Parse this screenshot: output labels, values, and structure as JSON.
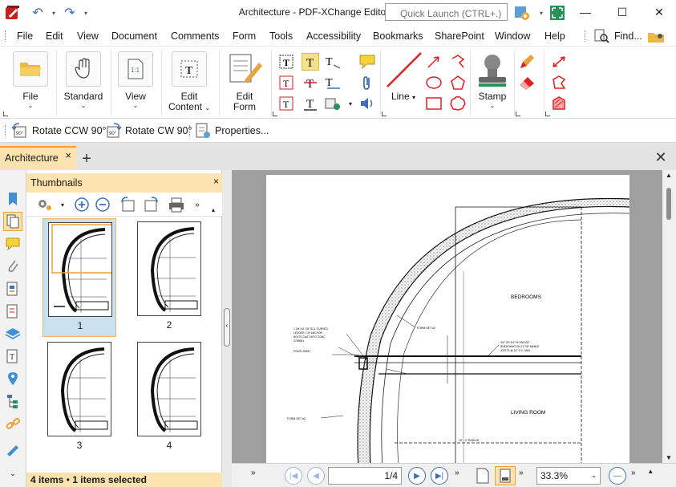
{
  "window": {
    "title": "Architecture - PDF-XChange Editor",
    "quick_launch_placeholder": "Quick Launch (CTRL+.)",
    "minimize": "—",
    "maximize": "☐",
    "close": "✕"
  },
  "menu": {
    "items": [
      "File",
      "Edit",
      "View",
      "Document",
      "Comments",
      "Form",
      "Tools",
      "Accessibility",
      "Bookmarks",
      "SharePoint",
      "Window",
      "Help"
    ],
    "find_label": "Find..."
  },
  "ribbon": {
    "file": "File",
    "standard": "Standard",
    "view": "View",
    "edit_content_1": "Edit",
    "edit_content_2": "Content",
    "edit_form_1": "Edit",
    "edit_form_2": "Form",
    "line": "Line",
    "stamp": "Stamp"
  },
  "toolbar2": {
    "rotate_ccw": "Rotate CCW 90°",
    "rotate_cw": "Rotate CW 90°",
    "properties": "Properties..."
  },
  "tabs": {
    "doc_tab": "Architecture",
    "close_tab": "×",
    "new_tab": "+",
    "close_all": "✕"
  },
  "thumbnails": {
    "title": "Thumbnails",
    "close": "×",
    "pages": [
      "1",
      "2",
      "3",
      "4"
    ],
    "status_count": "4 items",
    "status_selected": "1 items selected"
  },
  "drawing": {
    "bedrooms": "BEDROOMS",
    "living_room": "LIVING ROOM",
    "form_set": "FORM SET #2",
    "form_set_2": "FORM SET #2",
    "pour_joint": "POUR JOINT",
    "note_left_1": "1 3/4\"x11 7/8\" SCL 'CURVED",
    "note_left_2": "LEDGER. CIV ANCHOR",
    "note_left_3": "BOLTS CAST INTO CONC",
    "note_left_4": "CORBEL",
    "note_right_1": "3/4\" OR 3/4\" PLYWOOD",
    "note_right_2": "SHEATHING ON 11 7/8\" MANUF",
    "note_right_3": "JOISTS @ 16\" O.C. MAX",
    "radius": "15' - 0\" RADIUS"
  },
  "nav": {
    "page_display": "1/4",
    "zoom": "33.3%"
  },
  "colors": {
    "accent": "#e8a33c",
    "tab_bg": "#fbe3b0",
    "selection": "#cbe0ef",
    "link_blue": "#3f6fb8"
  }
}
